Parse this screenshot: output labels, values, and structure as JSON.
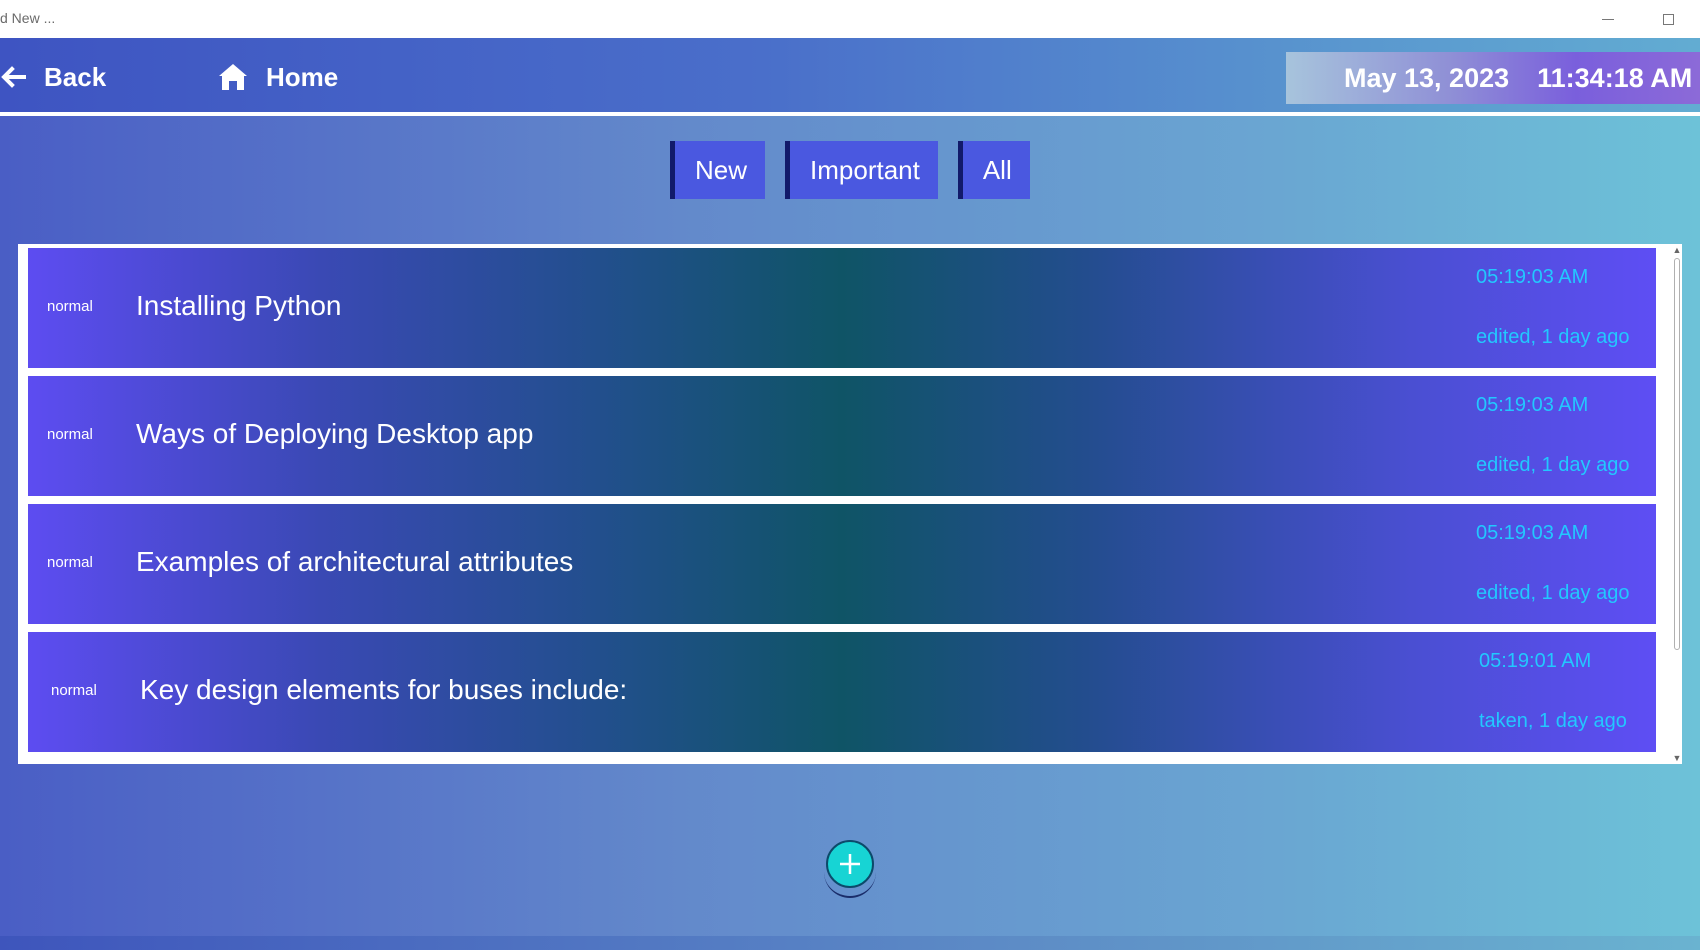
{
  "window": {
    "title": "d New ..."
  },
  "header": {
    "back_label": "Back",
    "home_label": "Home",
    "date": "May 13, 2023",
    "time": "11:34:18 AM"
  },
  "filters": {
    "tabs": [
      {
        "label": "New"
      },
      {
        "label": "Important"
      },
      {
        "label": "All"
      }
    ]
  },
  "notes": [
    {
      "priority": "normal",
      "title": "Installing Python",
      "time": "05:19:03 AM",
      "status": "edited, 1 day ago"
    },
    {
      "priority": "normal",
      "title": "Ways of Deploying Desktop app",
      "time": "05:19:03 AM",
      "status": "edited, 1 day ago"
    },
    {
      "priority": "normal",
      "title": "Examples of architectural attributes",
      "time": "05:19:03 AM",
      "status": "edited, 1 day ago"
    },
    {
      "priority": "normal",
      "title": "Key design elements for buses include:",
      "time": "05:19:01 AM",
      "status": "taken, 1 day ago"
    }
  ],
  "colors": {
    "accent_cyan": "#22c8ff",
    "tab_blue": "#4a58e0",
    "add_button": "#17d4d4"
  },
  "icons": {
    "back": "arrow-left-icon",
    "home": "home-icon",
    "add": "plus-icon"
  }
}
